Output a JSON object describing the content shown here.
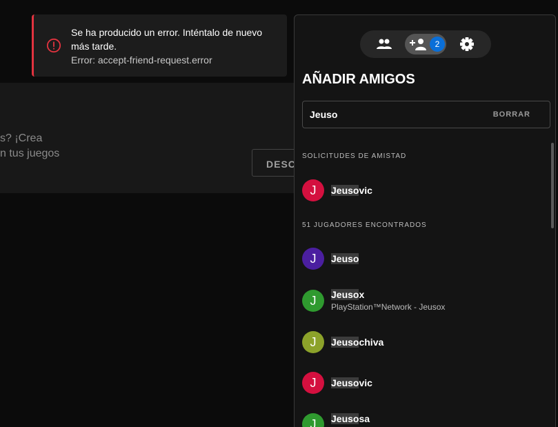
{
  "background": {
    "text_line1": "s? ¡Crea",
    "text_line2": "n tus juegos",
    "button_label": "DESC"
  },
  "toast": {
    "icon": "alert-circle-icon",
    "title": "Se ha producido un error. Inténtalo de nuevo más tarde.",
    "subtitle": "Error: accept-friend-request.error",
    "accent_color": "#e2333f"
  },
  "panel": {
    "tabs": [
      {
        "icon": "friends-icon"
      },
      {
        "icon": "add-friend-icon",
        "badge": "2"
      },
      {
        "icon": "gear-icon"
      }
    ],
    "title": "AÑADIR AMIGOS",
    "search": {
      "value": "Jeuso",
      "clear_label": "BORRAR"
    },
    "requests_label": "SOLICITUDES DE AMISTAD",
    "requests": [
      {
        "initial": "J",
        "match": "Jeuso",
        "rest": "vic",
        "color": "#d4103f"
      }
    ],
    "results_label": "51 JUGADORES ENCONTRADOS",
    "results": [
      {
        "initial": "J",
        "match": "Jeuso",
        "rest": "",
        "color": "#4b1fa0"
      },
      {
        "initial": "J",
        "match": "Jeuso",
        "rest": "x",
        "sub": "PlayStation™Network - Jeusox",
        "color": "#2f9a2f"
      },
      {
        "initial": "J",
        "match": "Jeuso",
        "rest": "chiva",
        "color": "#8ca22a"
      },
      {
        "initial": "J",
        "match": "Jeuso",
        "rest": "vic",
        "color": "#d4103f"
      },
      {
        "initial": "J",
        "match": "Jeuso",
        "rest": "sa",
        "color": "#2f9a2f"
      }
    ]
  }
}
